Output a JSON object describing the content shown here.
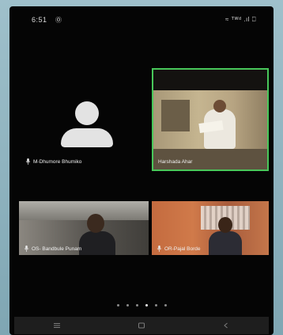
{
  "status_bar": {
    "time": "6:51",
    "left_icon": "Ⓞ",
    "right_text": "≈ ᵀᵂᵈ .ıl ⎕"
  },
  "participants": [
    {
      "name": "M-Dhumore Bhumiko",
      "video": false,
      "active_speaker": false,
      "muted_icon": "mic-icon"
    },
    {
      "name": "Harshada Ahar",
      "video": true,
      "active_speaker": true
    },
    {
      "name": "OS- Bandbule Punam",
      "video": true,
      "active_speaker": false,
      "muted_icon": "mic-icon"
    },
    {
      "name": "OR-Pajal Borde",
      "video": true,
      "active_speaker": false,
      "muted_icon": "mic-icon"
    }
  ],
  "pagination": {
    "total": 6,
    "active_index": 3
  },
  "nav_bar": {
    "buttons": [
      "menu-icon",
      "home-square-icon",
      "back-arrow-icon"
    ]
  },
  "colors": {
    "active_speaker_border": "#48c75a",
    "background": "#050505"
  }
}
